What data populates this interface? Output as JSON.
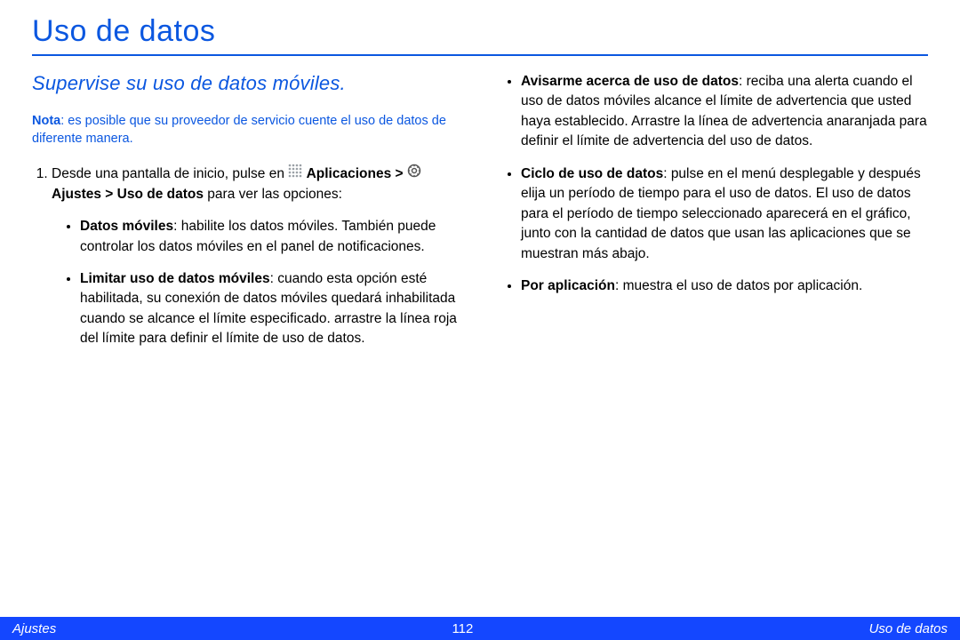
{
  "title": "Uso de datos",
  "subtitle": "Supervise su uso de datos móviles.",
  "note": {
    "label": "Nota",
    "text": ": es posible que su proveedor de servicio cuente el uso de datos de diferente manera."
  },
  "step1": {
    "pre": "Desde una pantalla de inicio, pulse en ",
    "apps": "Aplicaciones",
    "settings": "Ajustes",
    "datausage": "Uso de datos",
    "tail": " para ver las opciones:"
  },
  "bullets_left": [
    {
      "bold": "Datos móviles",
      "text": ": habilite los datos móviles. También puede controlar los datos móviles en el panel de notificaciones."
    },
    {
      "bold": "Limitar uso de datos móviles",
      "text": ": cuando esta opción esté habilitada, su conexión de datos móviles quedará inhabilitada cuando se alcance el límite especificado. arrastre la línea roja del límite para definir el límite de uso de datos."
    }
  ],
  "bullets_right": [
    {
      "bold": "Avisarme acerca de uso de datos",
      "text": ": reciba una alerta cuando el uso de datos móviles alcance el límite de advertencia que usted haya establecido. Arrastre la línea de advertencia anaranjada para definir el límite de advertencia del uso de datos."
    },
    {
      "bold": "Ciclo de uso de datos",
      "text": ": pulse en el menú desplegable y después elija un período de tiempo para el uso de datos. El uso de datos para el período de tiempo seleccionado aparecerá en el gráfico, junto con la cantidad de datos que usan las aplicaciones que se muestran más abajo."
    },
    {
      "bold": "Por aplicación",
      "text": ": muestra el uso de datos por aplicación."
    }
  ],
  "footer": {
    "left": "Ajustes",
    "center": "112",
    "right": "Uso de datos"
  }
}
